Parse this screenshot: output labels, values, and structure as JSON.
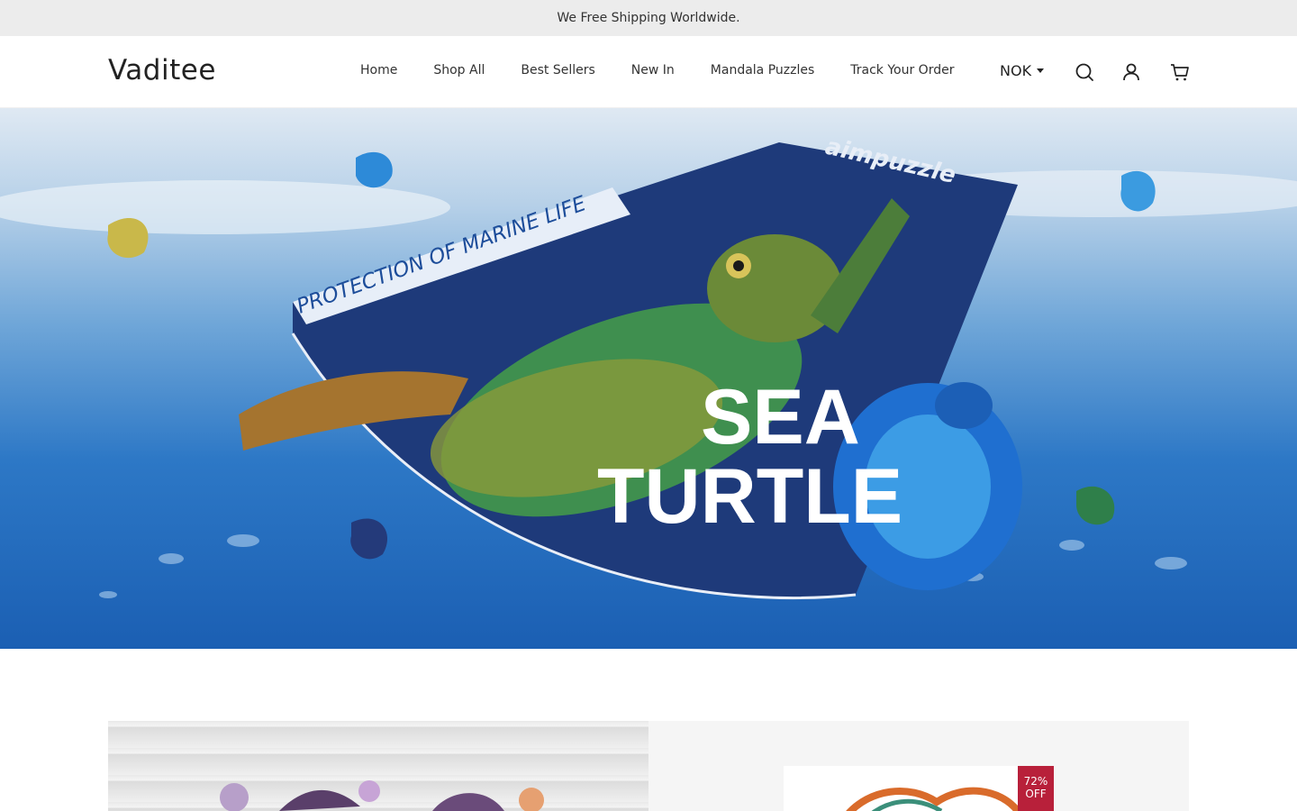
{
  "announcement": {
    "text": "We Free Shipping Worldwide."
  },
  "header": {
    "logo": "Vaditee",
    "nav": [
      "Home",
      "Shop All",
      "Best Sellers",
      "New In",
      "Mandala Puzzles",
      "Track Your Order"
    ],
    "currency": "NOK",
    "icons": [
      "search-icon",
      "account-icon",
      "cart-icon"
    ]
  },
  "hero": {
    "banner_brand": "aimpuzzle",
    "banner_tagline": "PROTECTION OF MARINE LIFE",
    "title_line1": "SEA",
    "title_line2": "TURTLE"
  },
  "featured": {
    "badge_percent": "72%",
    "badge_label": "OFF"
  },
  "colors": {
    "announcement_bg": "#ececec",
    "puzzle_navy": "#1e3a7a",
    "badge_red": "#b8203a"
  }
}
